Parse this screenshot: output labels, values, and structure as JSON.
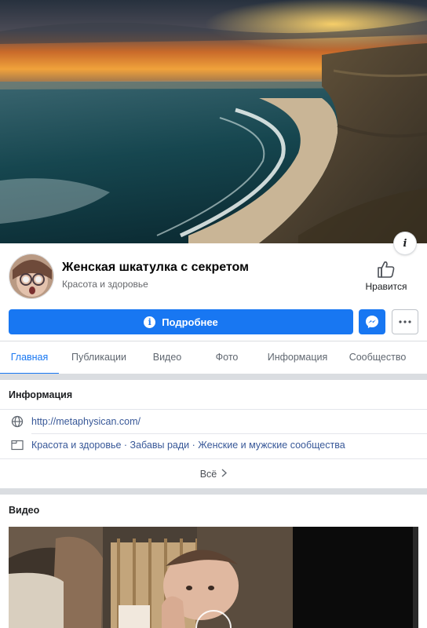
{
  "page": {
    "name": "Женская шкатулка с секретом",
    "category": "Красота и здоровье"
  },
  "like_button": {
    "label": "Нравится",
    "icon": "thumbs-up-icon"
  },
  "actions": {
    "more_info_label": "Подробнее",
    "more_info_icon": "info-icon",
    "messenger_icon": "messenger-icon",
    "more_icon": "ellipsis-icon"
  },
  "tabs": [
    {
      "label": "Главная",
      "active": true
    },
    {
      "label": "Публикации",
      "active": false
    },
    {
      "label": "Видео",
      "active": false
    },
    {
      "label": "Фото",
      "active": false
    },
    {
      "label": "Информация",
      "active": false
    },
    {
      "label": "Сообщество",
      "active": false
    }
  ],
  "info_section": {
    "title": "Информация",
    "website": "http://metaphysican.com/",
    "categories": "Красота и здоровье · Забавы ради · Женские и мужские сообщества",
    "see_all": "Всё"
  },
  "video_section": {
    "title": "Видео"
  },
  "colors": {
    "accent": "#1877f2",
    "link": "#385898",
    "muted": "#65676b",
    "divider": "#dadde1"
  }
}
